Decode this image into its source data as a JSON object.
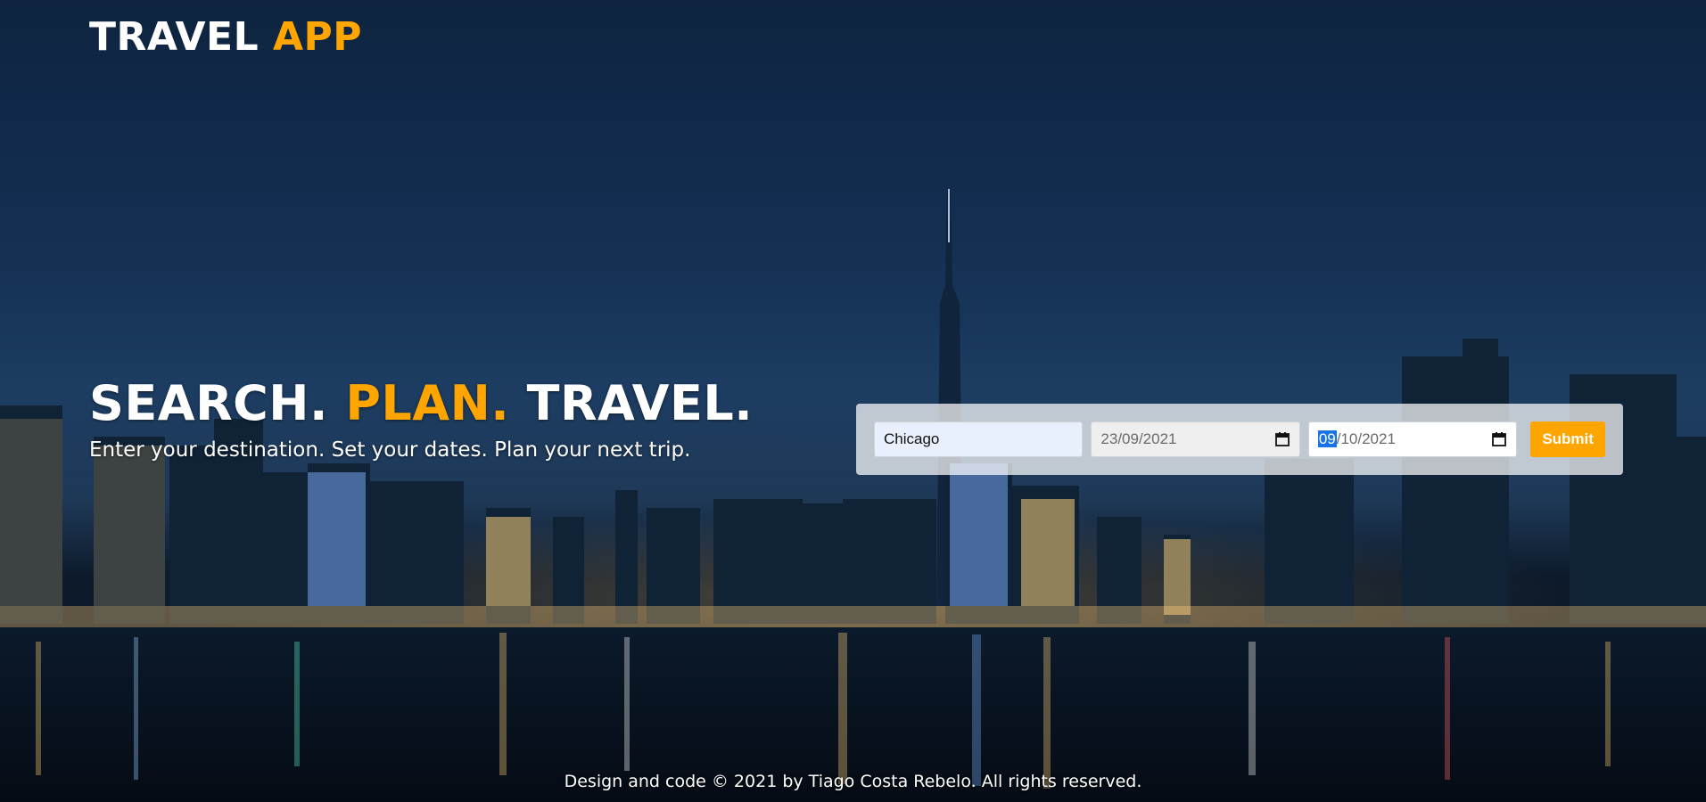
{
  "header": {
    "logo_primary": "TRAVEL",
    "logo_accent": "APP"
  },
  "hero": {
    "headline_part1": "SEARCH.",
    "headline_accent": "PLAN.",
    "headline_part3": "TRAVEL.",
    "subtitle": "Enter your destination. Set your dates. Plan your next trip."
  },
  "search": {
    "destination_value": "Chicago",
    "start_date": "23/09/2021",
    "end_date_selected": "09",
    "end_date_rest": "/10/2021",
    "submit_label": "Submit"
  },
  "footer": {
    "text": "Design and code © 2021 by Tiago Costa Rebelo. All rights reserved."
  },
  "colors": {
    "accent": "#ffa500",
    "text": "#ffffff"
  },
  "icons": {
    "calendar": "calendar-icon"
  }
}
